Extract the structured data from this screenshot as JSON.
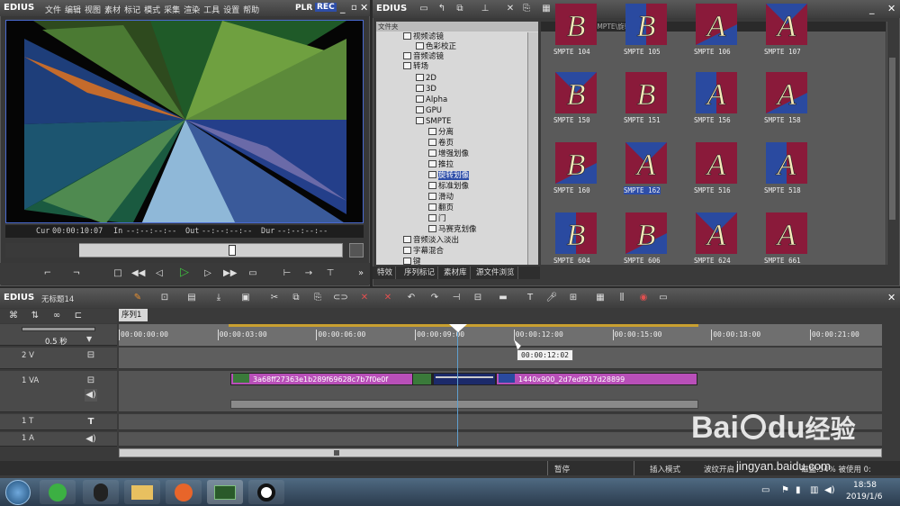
{
  "player": {
    "logo": "EDIUS",
    "menu": [
      "文件",
      "编辑",
      "视图",
      "素材",
      "标记",
      "模式",
      "采集",
      "渲染",
      "工具",
      "设置",
      "帮助"
    ],
    "plr": "PLR",
    "rec": "REC",
    "cur_label": "Cur",
    "cur_value": "00:00:10:07",
    "in_label": "In",
    "in_value": "--:--:--:--",
    "out_label": "Out",
    "out_value": "--:--:--:--",
    "dur_label": "Dur",
    "dur_value": "--:--:--:--"
  },
  "bin": {
    "logo": "EDIUS",
    "folder_header": "文件夹",
    "path": "\\特效\\转场\\SMPTE\\旋转划像",
    "tree": [
      "视频滤镜",
      "色彩校正",
      "音频滤镜",
      "转场",
      "2D",
      "3D",
      "Alpha",
      "GPU",
      "SMPTE",
      "分离",
      "卷页",
      "增强划像",
      "推拉",
      "旋转划像",
      "标准划像",
      "滑动",
      "翻页",
      "门",
      "马赛克划像",
      "音频淡入淡出",
      "字幕混合",
      "键"
    ],
    "tabs": [
      "特效",
      "序列标记",
      "素材库",
      "源文件浏览"
    ],
    "thumbs": [
      "SMPTE  104",
      "SMPTE  105",
      "SMPTE  106",
      "SMPTE  107",
      "SMPTE  150",
      "SMPTE  151",
      "SMPTE  156",
      "SMPTE  158",
      "SMPTE  160",
      "SMPTE  162",
      "SMPTE  516",
      "SMPTE  518",
      "SMPTE  604",
      "SMPTE  606",
      "SMPTE  624",
      "SMPTE  661"
    ],
    "thumb_letters": [
      "B",
      "B",
      "A",
      "A",
      "B",
      "B",
      "A",
      "A",
      "B",
      "A",
      "A",
      "A",
      "B",
      "B",
      "A",
      "A"
    ]
  },
  "timeline": {
    "logo": "EDIUS",
    "project": "无标题14",
    "seq_tab": "序列1",
    "zoom": "0.5 秒",
    "ticks": [
      "00:00:00:00",
      "00:00:03:00",
      "00:00:06:00",
      "00:00:09:00",
      "00:00:12:00",
      "00:00:15:00",
      "00:00:18:00",
      "00:00:21:00"
    ],
    "tooltip": "00:00:12:02",
    "tracks": [
      "2 V",
      "1 VA",
      "1 T",
      "1 A"
    ],
    "clip1": "3a68ff27363e1b289f69628c7b7f0e0f",
    "clip2": "1440x900_2d7edf917d28899"
  },
  "status": {
    "pause": "暂停",
    "insert": "插入模式",
    "ripple": "波纹开启",
    "disk": "磁盘:54% 被使用 0:"
  },
  "taskbar": {
    "time": "18:58",
    "date": "2019/1/6"
  },
  "watermark": {
    "brand": "Bai",
    "brand2": "du",
    "cn": "经验",
    "url": "jingyan.baidu.com"
  },
  "colors": {
    "accent_blue": "#2e4ea8",
    "clip_purple": "#b84fb8",
    "thumb_red": "#8a1a3a",
    "thumb_blue": "#2a4aa0",
    "play_green": "#3fbf3f"
  }
}
